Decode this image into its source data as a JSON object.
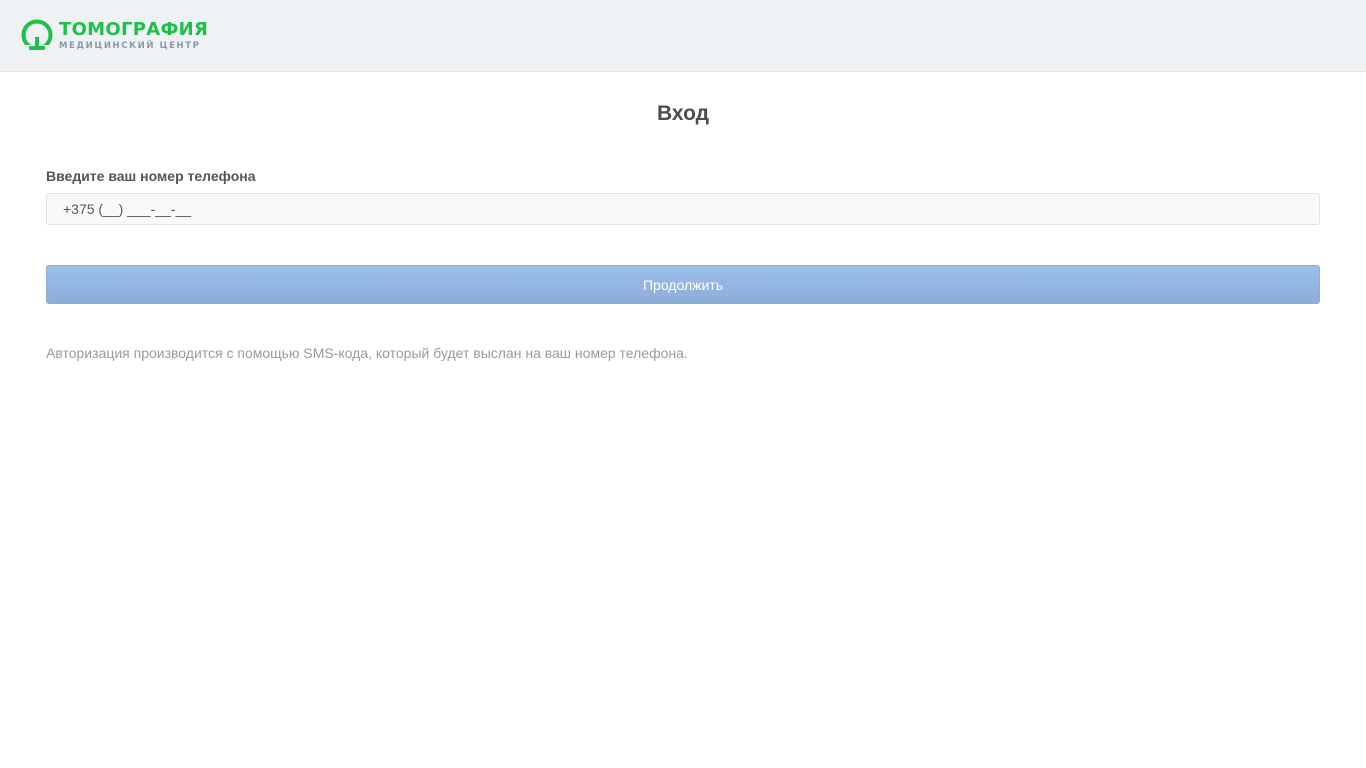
{
  "header": {
    "logo": {
      "title": "ТОМОГРАФИЯ",
      "subtitle": "МЕДИЦИНСКИЙ ЦЕНТР",
      "mark_icon": "omega-logo-icon",
      "brand_color": "#1fbf48",
      "subtitle_color": "#8c98a6"
    },
    "background_color": "#eef2f5"
  },
  "login": {
    "title": "Вход",
    "phone_label": "Введите ваш номер телефона",
    "phone_value": "+375 (__) ___-__-__",
    "continue_label": "Продолжить",
    "continue_disabled": true,
    "button_color": "#94b6e0",
    "hint": "Авторизация производится с помощью SMS-кода, который будет выслан на ваш номер телефона."
  }
}
